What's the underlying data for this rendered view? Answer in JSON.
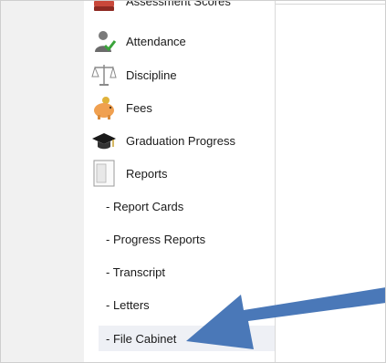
{
  "sidebar": {
    "items": [
      {
        "label": "Assessment Scores",
        "icon": "book-stack-icon"
      },
      {
        "label": "Attendance",
        "icon": "person-check-icon"
      },
      {
        "label": "Discipline",
        "icon": "scales-icon"
      },
      {
        "label": "Fees",
        "icon": "piggy-bank-icon"
      },
      {
        "label": "Graduation Progress",
        "icon": "graduation-cap-icon"
      },
      {
        "label": "Reports",
        "icon": "document-icon"
      }
    ],
    "report_links": [
      {
        "label": "- Report Cards"
      },
      {
        "label": "- Progress Reports"
      },
      {
        "label": "- Transcript"
      },
      {
        "label": "- Letters"
      },
      {
        "label": "- File Cabinet"
      }
    ],
    "active_link": "- File Cabinet"
  },
  "annotation": {
    "type": "arrow",
    "color": "#4a78b8"
  }
}
